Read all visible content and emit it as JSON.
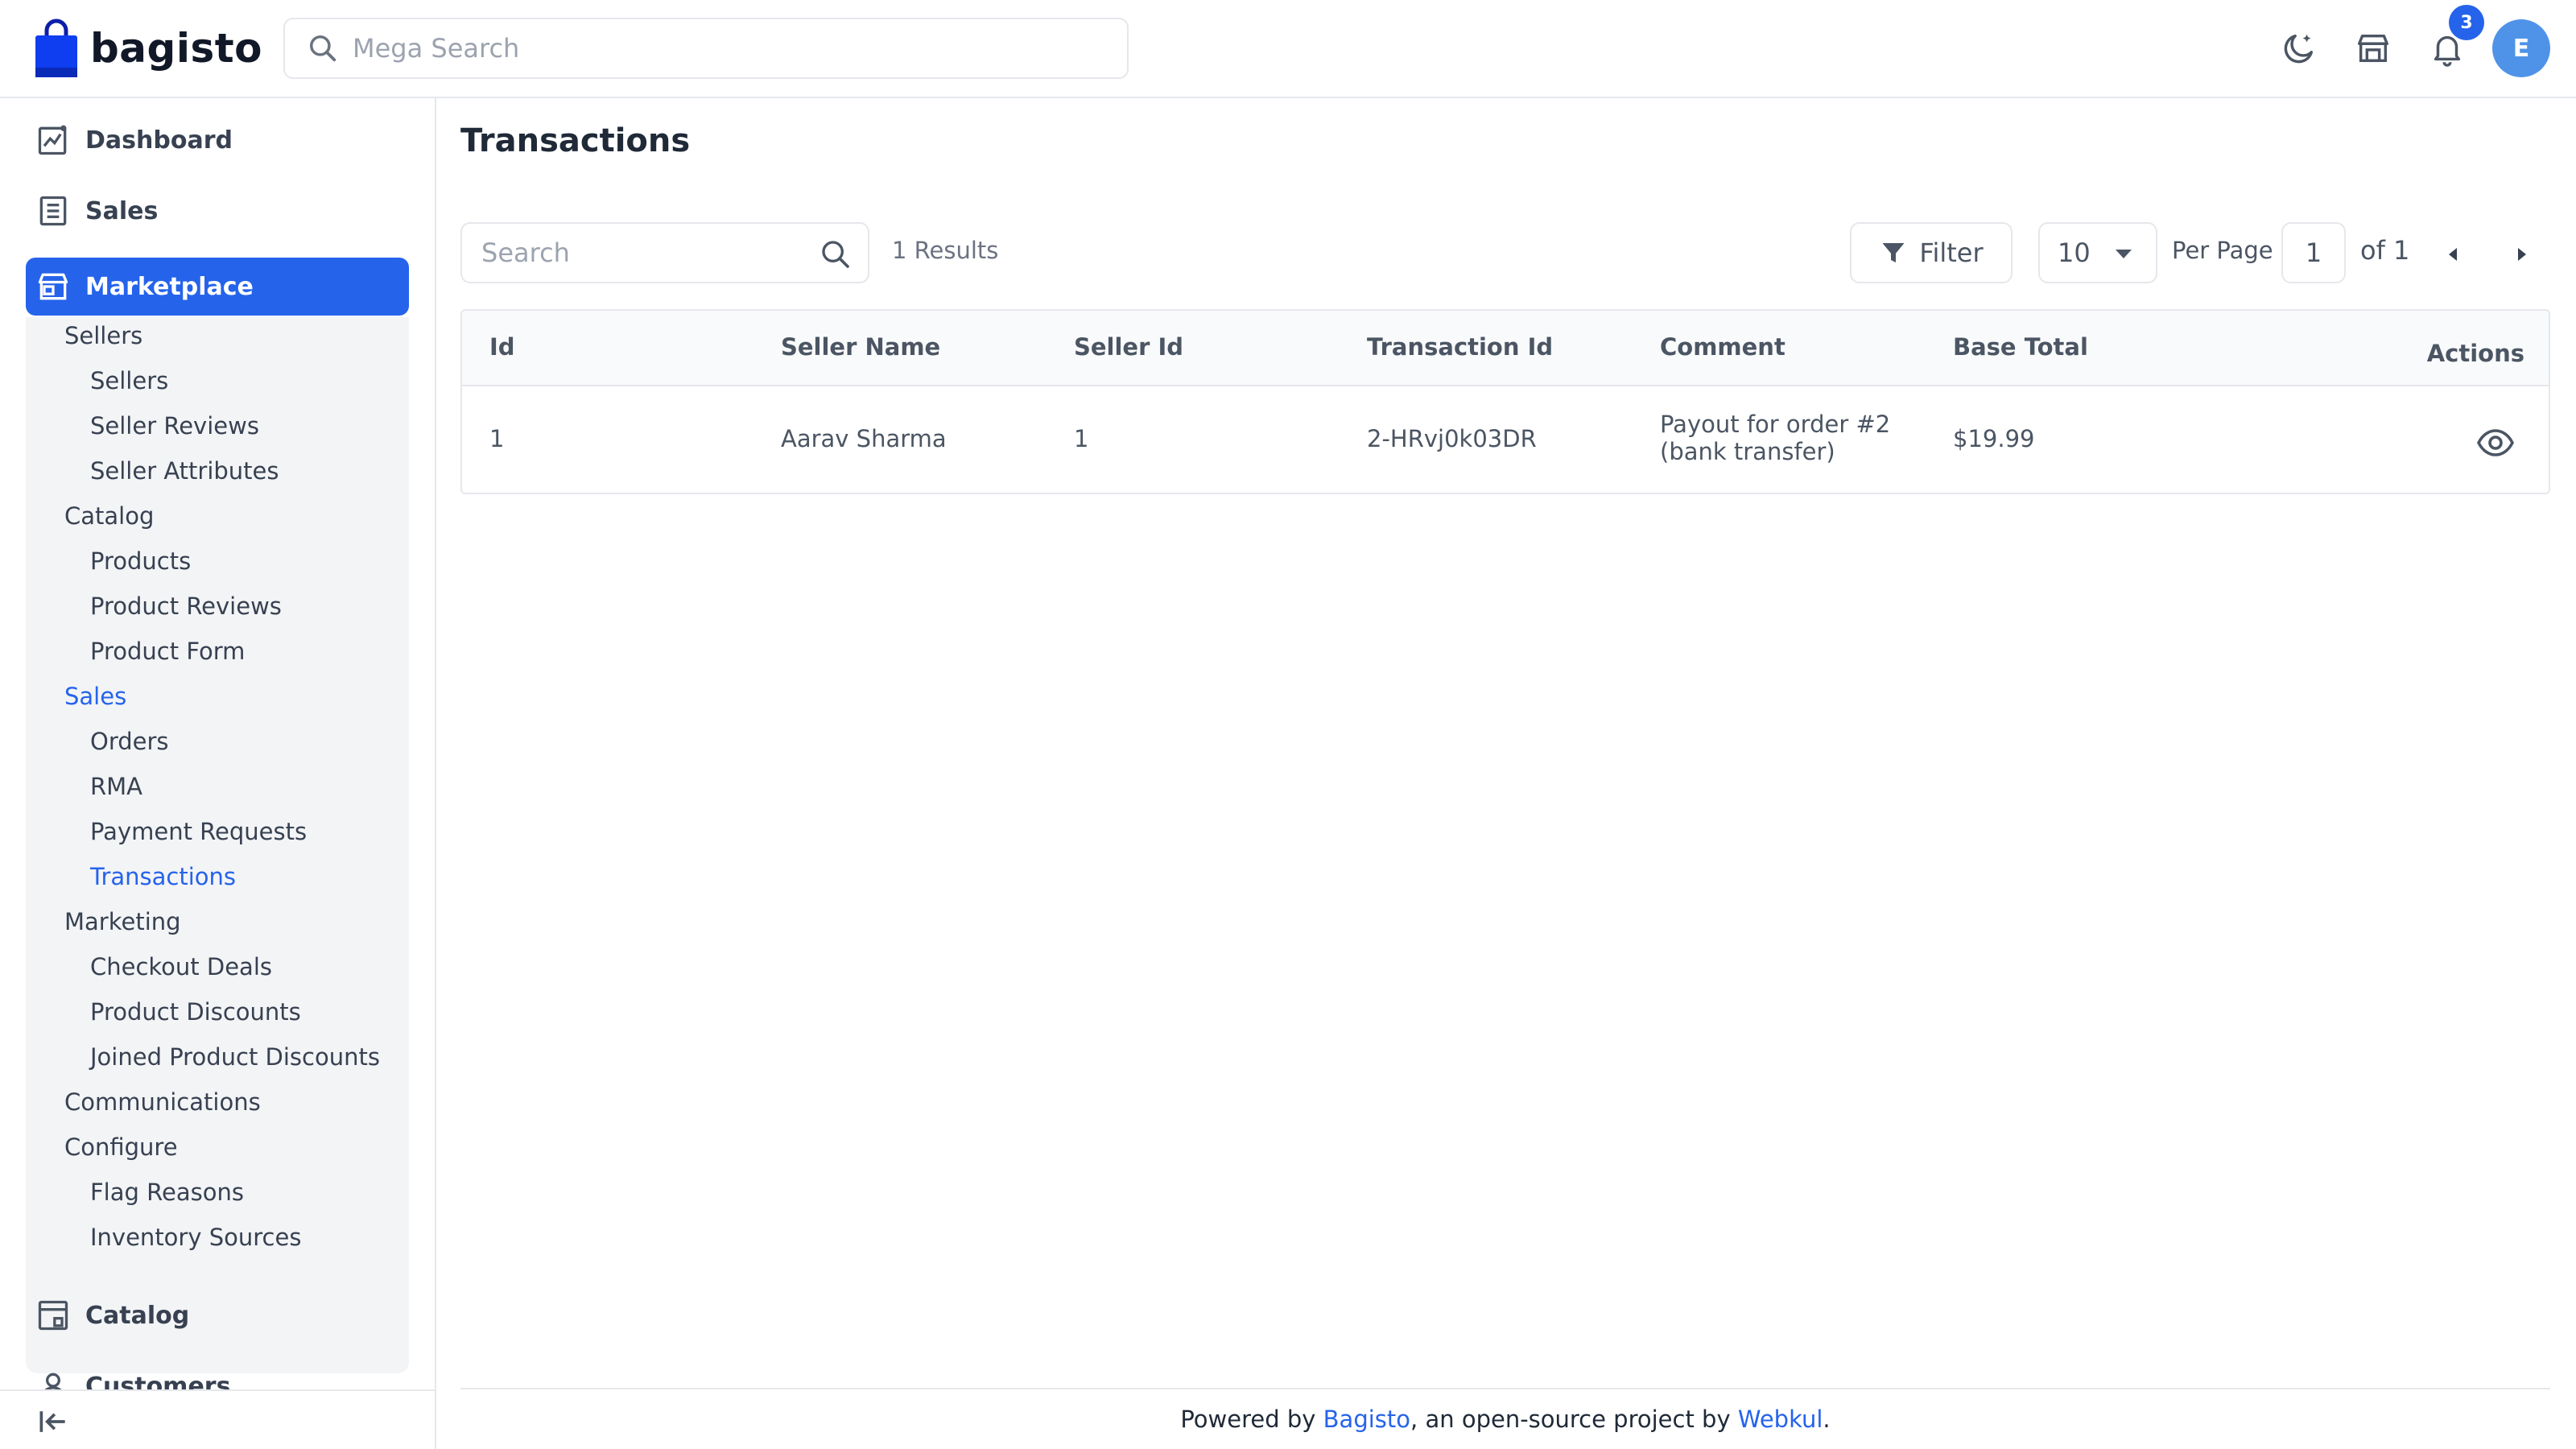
{
  "header": {
    "logo_text": "bagisto",
    "search_placeholder": "Mega Search",
    "notification_count": "3",
    "avatar_initial": "E"
  },
  "sidebar": {
    "top_items": [
      {
        "label": "Dashboard",
        "icon": "dashboard-icon"
      },
      {
        "label": "Sales",
        "icon": "sales-icon"
      },
      {
        "label": "Marketplace",
        "icon": "store-icon",
        "active": true
      }
    ],
    "marketplace_menu": [
      {
        "label": "Sellers",
        "level": 1
      },
      {
        "label": "Sellers",
        "level": 2
      },
      {
        "label": "Seller Reviews",
        "level": 2
      },
      {
        "label": "Seller Attributes",
        "level": 2
      },
      {
        "label": "Catalog",
        "level": 1
      },
      {
        "label": "Products",
        "level": 2
      },
      {
        "label": "Product Reviews",
        "level": 2
      },
      {
        "label": "Product Form",
        "level": 2
      },
      {
        "label": "Sales",
        "level": 1,
        "active": true
      },
      {
        "label": "Orders",
        "level": 2
      },
      {
        "label": "RMA",
        "level": 2
      },
      {
        "label": "Payment Requests",
        "level": 2
      },
      {
        "label": "Transactions",
        "level": 2,
        "active": true
      },
      {
        "label": "Marketing",
        "level": 1
      },
      {
        "label": "Checkout Deals",
        "level": 2
      },
      {
        "label": "Product Discounts",
        "level": 2
      },
      {
        "label": "Joined Product Discounts",
        "level": 2
      },
      {
        "label": "Communications",
        "level": 1
      },
      {
        "label": "Configure",
        "level": 1
      },
      {
        "label": "Flag Reasons",
        "level": 2
      },
      {
        "label": "Inventory Sources",
        "level": 2
      }
    ],
    "bottom_items": [
      {
        "label": "Catalog",
        "icon": "catalog-icon"
      },
      {
        "label": "Customers",
        "icon": "customers-icon"
      }
    ]
  },
  "main": {
    "title": "Transactions",
    "search_placeholder": "Search",
    "results_text": "1 Results",
    "filter_label": "Filter",
    "per_page_value": "10",
    "per_page_label": "Per Page",
    "current_page": "1",
    "of_pages": "of 1"
  },
  "table": {
    "columns": [
      "Id",
      "Seller Name",
      "Seller Id",
      "Transaction Id",
      "Comment",
      "Base Total",
      "Actions"
    ],
    "rows": [
      {
        "id": "1",
        "seller_name": "Aarav Sharma",
        "seller_id": "1",
        "transaction_id": "2-HRvj0k03DR",
        "comment_line1": "Payout for order #2",
        "comment_line2": "(bank transfer)",
        "base_total": "$19.99"
      }
    ]
  },
  "footer": {
    "prefix": "Powered by ",
    "link1": "Bagisto",
    "middle": ", an open-source project by ",
    "link2": "Webkul",
    "suffix": "."
  },
  "colors": {
    "accent": "#2563eb",
    "avatar": "#4f93e8"
  }
}
